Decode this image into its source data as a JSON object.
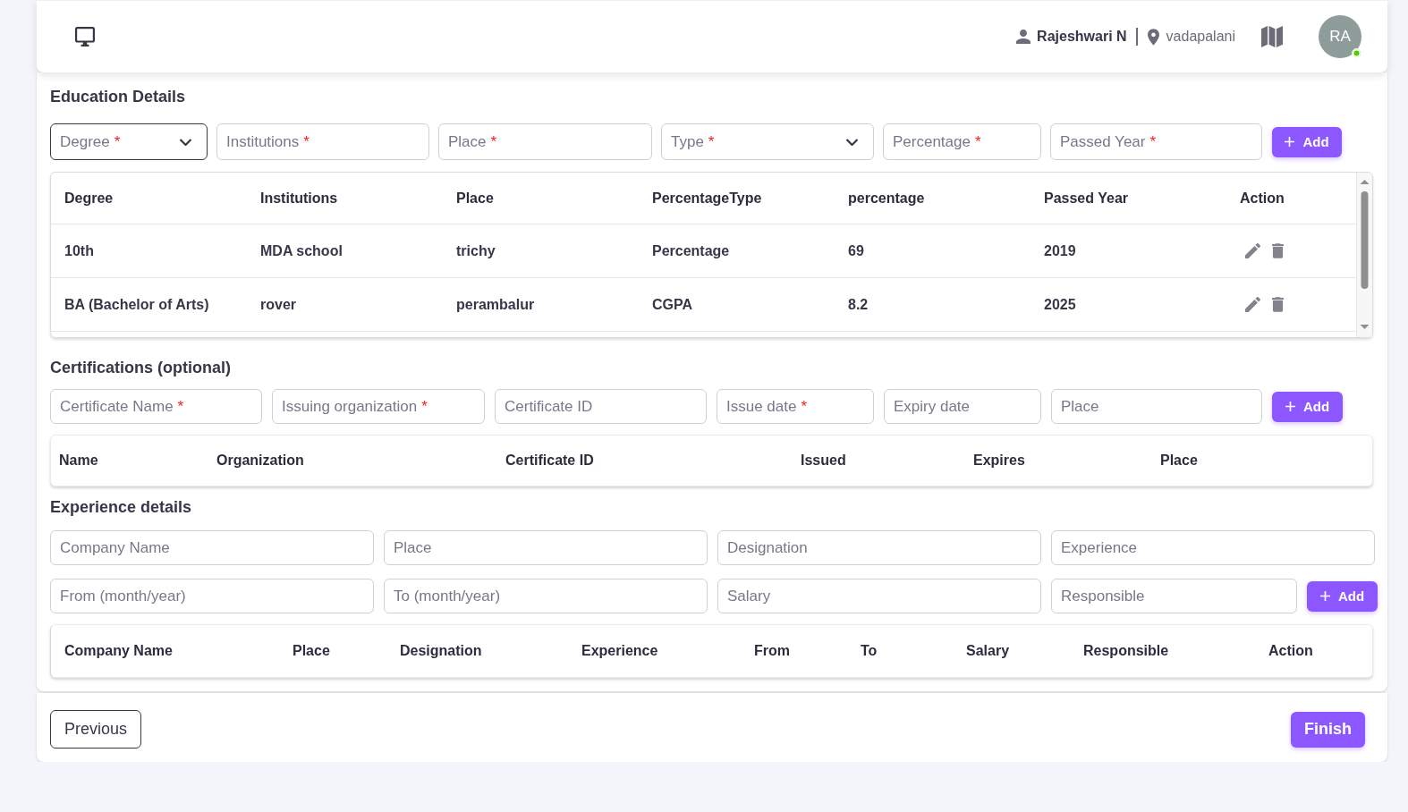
{
  "header": {
    "user_name": "Rajeshwari N",
    "location": "vadapalani",
    "avatar": {
      "initials": "RA",
      "online": true
    }
  },
  "education": {
    "title": "Education Details",
    "fields": [
      {
        "kind": "select",
        "placeholder": "Degree",
        "required_mark": "*",
        "focused": true
      },
      {
        "kind": "text",
        "placeholder": "Institutions",
        "required_mark": "*",
        "focused": false
      },
      {
        "kind": "text",
        "placeholder": "Place",
        "required_mark": "*",
        "focused": false
      },
      {
        "kind": "select",
        "placeholder": "Type",
        "required_mark": "*",
        "focused": false
      },
      {
        "kind": "text",
        "placeholder": "Percentage",
        "required_mark": "*",
        "focused": false
      },
      {
        "kind": "text",
        "placeholder": "Passed Year",
        "required_mark": "*",
        "focused": false
      }
    ],
    "add_button": "Add",
    "table": {
      "columns": [
        "Degree",
        "Institutions",
        "Place",
        "PercentageType",
        "percentage",
        "Passed Year",
        "Action"
      ],
      "rows": [
        {
          "cells": [
            "10th",
            "MDA school",
            "trichy",
            "Percentage",
            "69",
            "2019"
          ]
        },
        {
          "cells": [
            "BA (Bachelor of Arts)",
            "rover",
            "perambalur",
            "CGPA",
            "8.2",
            "2025"
          ]
        }
      ]
    }
  },
  "certifications": {
    "title": "Certifications (optional)",
    "fields": [
      {
        "kind": "text",
        "placeholder": "Certificate Name",
        "required_mark": "*",
        "focused": false
      },
      {
        "kind": "text",
        "placeholder": "Issuing organization",
        "required_mark": "*",
        "focused": false
      },
      {
        "kind": "text",
        "placeholder": "Certificate ID",
        "focused": false
      },
      {
        "kind": "text",
        "placeholder": "Issue date",
        "required_mark": "*",
        "focused": false
      },
      {
        "kind": "text",
        "placeholder": "Expiry date",
        "focused": false
      },
      {
        "kind": "text",
        "placeholder": "Place",
        "focused": false
      }
    ],
    "add_button": "Add",
    "table": {
      "columns": [
        "Name",
        "Organization",
        "Certificate ID",
        "Issued",
        "Expires",
        "Place"
      ]
    }
  },
  "experience": {
    "title": "Experience details",
    "field_rows": [
      [
        {
          "kind": "text",
          "placeholder": "Company Name",
          "focused": false
        },
        {
          "kind": "text",
          "placeholder": "Place",
          "focused": false
        },
        {
          "kind": "text",
          "placeholder": "Designation",
          "focused": false
        },
        {
          "kind": "text",
          "placeholder": "Experience",
          "focused": false
        }
      ],
      [
        {
          "kind": "text",
          "placeholder": "From (month/year)",
          "focused": false
        },
        {
          "kind": "text",
          "placeholder": "To (month/year)",
          "focused": false
        },
        {
          "kind": "text",
          "placeholder": "Salary",
          "focused": false
        },
        {
          "kind": "text",
          "placeholder": "Responsible",
          "focused": false
        }
      ]
    ],
    "add_button": "Add",
    "table": {
      "columns": [
        "Company Name",
        "Place",
        "Designation",
        "Experience",
        "From",
        "To",
        "Salary",
        "Responsible",
        "Action"
      ]
    }
  },
  "footer": {
    "previous_button": "Previous",
    "finish_button": "Finish"
  }
}
